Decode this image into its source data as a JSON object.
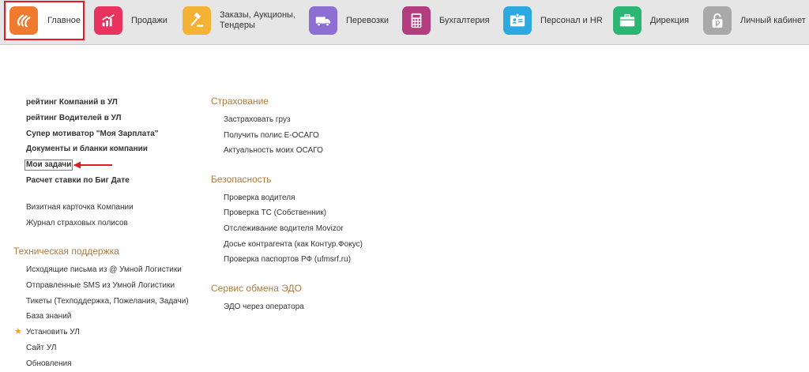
{
  "nav": {
    "items": [
      {
        "label": "Главное",
        "icon": "logo-icon"
      },
      {
        "label": "Продажи",
        "icon": "sales-chart-icon"
      },
      {
        "label": "Заказы,  Аукционы, Тендеры",
        "icon": "gavel-icon"
      },
      {
        "label": "Перевозки",
        "icon": "truck-icon"
      },
      {
        "label": "Бухгалтерия",
        "icon": "calculator-icon"
      },
      {
        "label": "Персонал и HR",
        "icon": "id-card-icon"
      },
      {
        "label": "Дирекция",
        "icon": "briefcase-icon"
      },
      {
        "label": "Личный кабинет",
        "icon": "ruble-lock-icon"
      }
    ],
    "colors": [
      "#f07a2e",
      "#e8335f",
      "#f5b335",
      "#8d6fd3",
      "#b13d7e",
      "#2ba9e0",
      "#2bb673",
      "#a9a9a9"
    ]
  },
  "left_column": {
    "bold_links": [
      "рейтинг Компаний в УЛ",
      "рейтинг Водителей в УЛ",
      "Супер мотиватор \"Моя Зарплата\"",
      "Документы и бланки компании",
      "Мои задачи",
      "Расчет ставки по Биг Дате"
    ],
    "links": [
      "Визитная карточка Компании",
      "Журнал страховых полисов"
    ],
    "support": {
      "title": "Техническая поддержка",
      "links": [
        "Исходящие письма из @ Умной Логистики",
        "Отправленные SMS из Умной Логистики",
        "Тикеты (Техподдержка, Пожелания, Задачи)",
        "База знаний",
        "Установить УЛ",
        "Сайт УЛ",
        "Обновления"
      ]
    }
  },
  "right_column": {
    "insurance": {
      "title": "Страхование",
      "links": [
        "Застраховать груз",
        "Получить полис Е-ОСАГО",
        "Актуальность моих ОСАГО"
      ]
    },
    "security": {
      "title": "Безопасность",
      "links": [
        "Проверка водителя",
        "Проверка ТС (Собственник)",
        "Отслеживание водителя Movizor",
        "Досье контрагента (как Контур.Фокус)",
        "Проверка паспортов РФ (ufmsrf.ru)"
      ]
    },
    "edo": {
      "title": "Сервис обмена ЭДО",
      "links": [
        "ЭДО через оператора"
      ]
    }
  }
}
